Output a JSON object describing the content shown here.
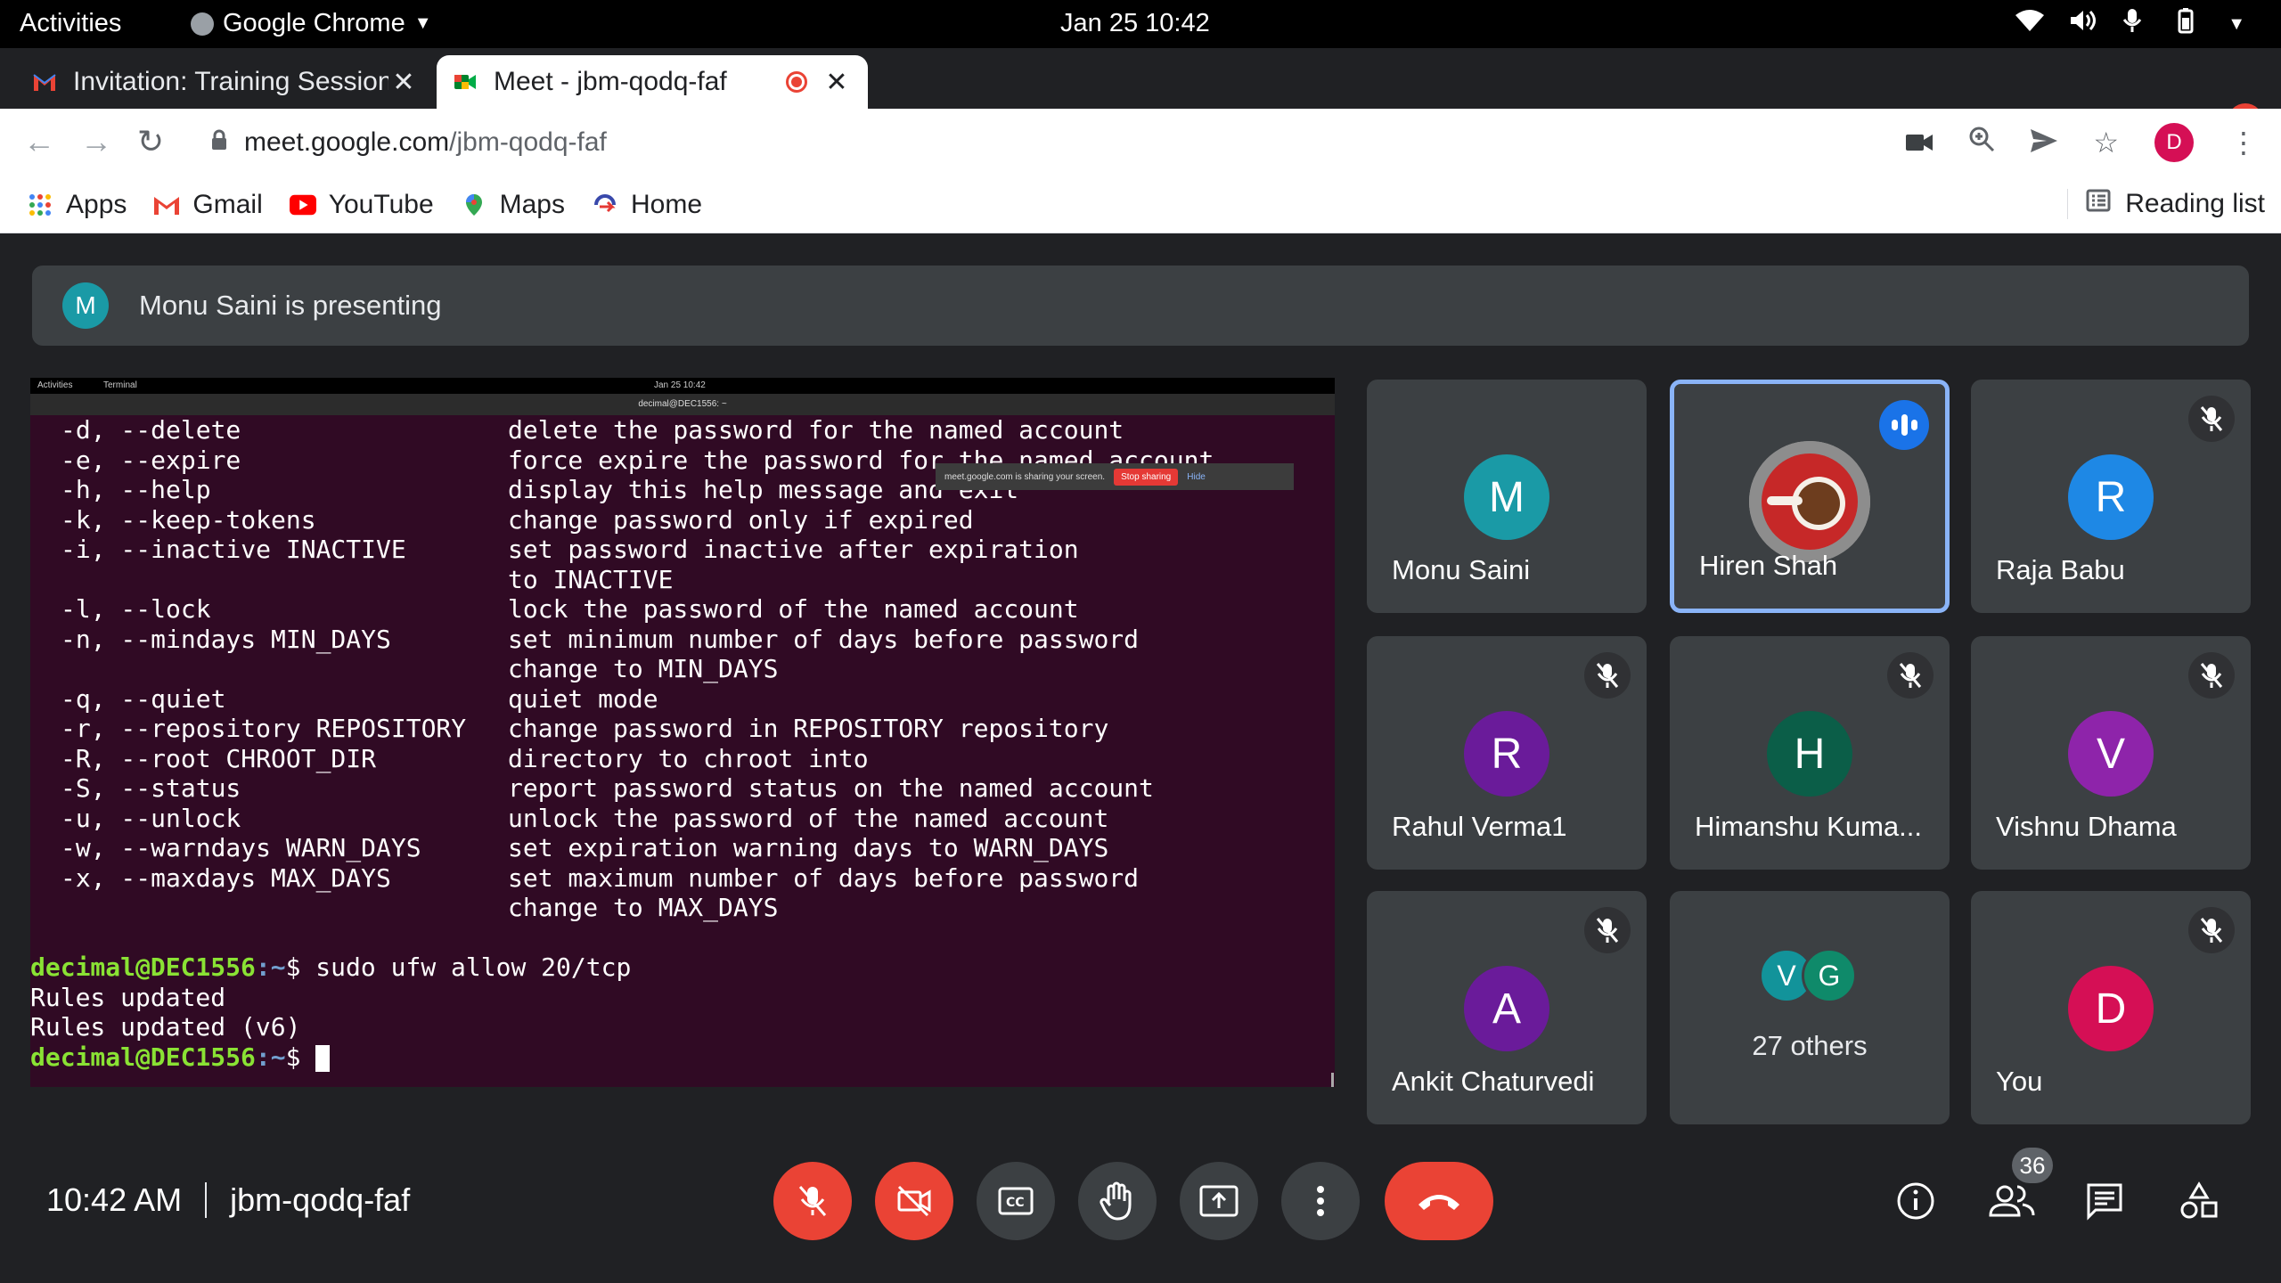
{
  "system": {
    "activities": "Activities",
    "app_name": "Google Chrome",
    "clock": "Jan 25  10:42"
  },
  "tabs": [
    {
      "title": "Invitation: Training Session",
      "icon": "gmail-icon"
    },
    {
      "title": "Meet - jbm-qodq-faf",
      "icon": "meet-icon",
      "recording": true
    }
  ],
  "address": {
    "host": "meet.google.com",
    "path": "/jbm-qodq-faf"
  },
  "profile_initial": "D",
  "bookmarks": [
    {
      "label": "Apps",
      "icon": "apps-grid-icon"
    },
    {
      "label": "Gmail",
      "icon": "gmail-icon"
    },
    {
      "label": "YouTube",
      "icon": "youtube-icon"
    },
    {
      "label": "Maps",
      "icon": "maps-icon"
    },
    {
      "label": "Home",
      "icon": "home-icon"
    }
  ],
  "reading_list": "Reading list",
  "banner": {
    "initial": "M",
    "text": "Monu Saini is presenting"
  },
  "shared_screen": {
    "mini_activities": "Activities",
    "mini_app": "Terminal",
    "mini_clock": "Jan 25  10:42",
    "mini_title": "decimal@DEC1556: ~",
    "share_notice": "meet.google.com is sharing your screen.",
    "stop_label": "Stop sharing",
    "hide_label": "Hide",
    "options": [
      {
        "flag": "-d, --delete",
        "desc": "delete the password for the named account"
      },
      {
        "flag": "-e, --expire",
        "desc": "force expire the password for the named account"
      },
      {
        "flag": "-h, --help",
        "desc": "display this help message and exit"
      },
      {
        "flag": "-k, --keep-tokens",
        "desc": "change password only if expired"
      },
      {
        "flag": "-i, --inactive INACTIVE",
        "desc": "set password inactive after expiration"
      },
      {
        "flag": "",
        "desc": "to INACTIVE"
      },
      {
        "flag": "-l, --lock",
        "desc": "lock the password of the named account"
      },
      {
        "flag": "-n, --mindays MIN_DAYS",
        "desc": "set minimum number of days before password"
      },
      {
        "flag": "",
        "desc": "change to MIN_DAYS"
      },
      {
        "flag": "-q, --quiet",
        "desc": "quiet mode"
      },
      {
        "flag": "-r, --repository REPOSITORY",
        "desc": "change password in REPOSITORY repository"
      },
      {
        "flag": "-R, --root CHROOT_DIR",
        "desc": "directory to chroot into"
      },
      {
        "flag": "-S, --status",
        "desc": "report password status on the named account"
      },
      {
        "flag": "-u, --unlock",
        "desc": "unlock the password of the named account"
      },
      {
        "flag": "-w, --warndays WARN_DAYS",
        "desc": "set expiration warning days to WARN_DAYS"
      },
      {
        "flag": "-x, --maxdays MAX_DAYS",
        "desc": "set maximum number of days before password"
      },
      {
        "flag": "",
        "desc": "change to MAX_DAYS"
      }
    ],
    "prompt_user": "decimal@DEC1556",
    "prompt_path": ":~",
    "prompt_symbol": "$",
    "command": " sudo ufw allow 20/tcp",
    "output": [
      "Rules updated",
      "Rules updated (v6)"
    ]
  },
  "participants": [
    {
      "name": "Monu Saini",
      "initial": "M",
      "color": "#1a9aa6",
      "muted": false
    },
    {
      "name": "Hiren Shah",
      "initial": "",
      "color": "#c62828",
      "muted": false,
      "speaking": true
    },
    {
      "name": "Raja Babu",
      "initial": "R",
      "color": "#1e88e5",
      "muted": true
    },
    {
      "name": "Rahul Verma1",
      "initial": "R",
      "color": "#6a1b9a",
      "muted": true
    },
    {
      "name": "Himanshu Kuma...",
      "initial": "H",
      "color": "#0b5e48",
      "muted": true
    },
    {
      "name": "Vishnu Dhama",
      "initial": "V",
      "color": "#8e24aa",
      "muted": true
    },
    {
      "name": "Ankit Chaturvedi",
      "initial": "A",
      "color": "#6a1b9a",
      "muted": true
    },
    {
      "name": "You",
      "initial": "D",
      "color": "#d50f55",
      "muted": true
    }
  ],
  "others": {
    "label": "27 others",
    "initials": [
      "V",
      "G"
    ],
    "colors": [
      "#12939a",
      "#0f8a6a"
    ]
  },
  "meeting": {
    "time": "10:42 AM",
    "code": "jbm-qodq-faf"
  },
  "people_count": "36",
  "accent_colors": {
    "danger": "#ea4335",
    "speaking": "#8ab4f8",
    "bg": "#202124"
  }
}
